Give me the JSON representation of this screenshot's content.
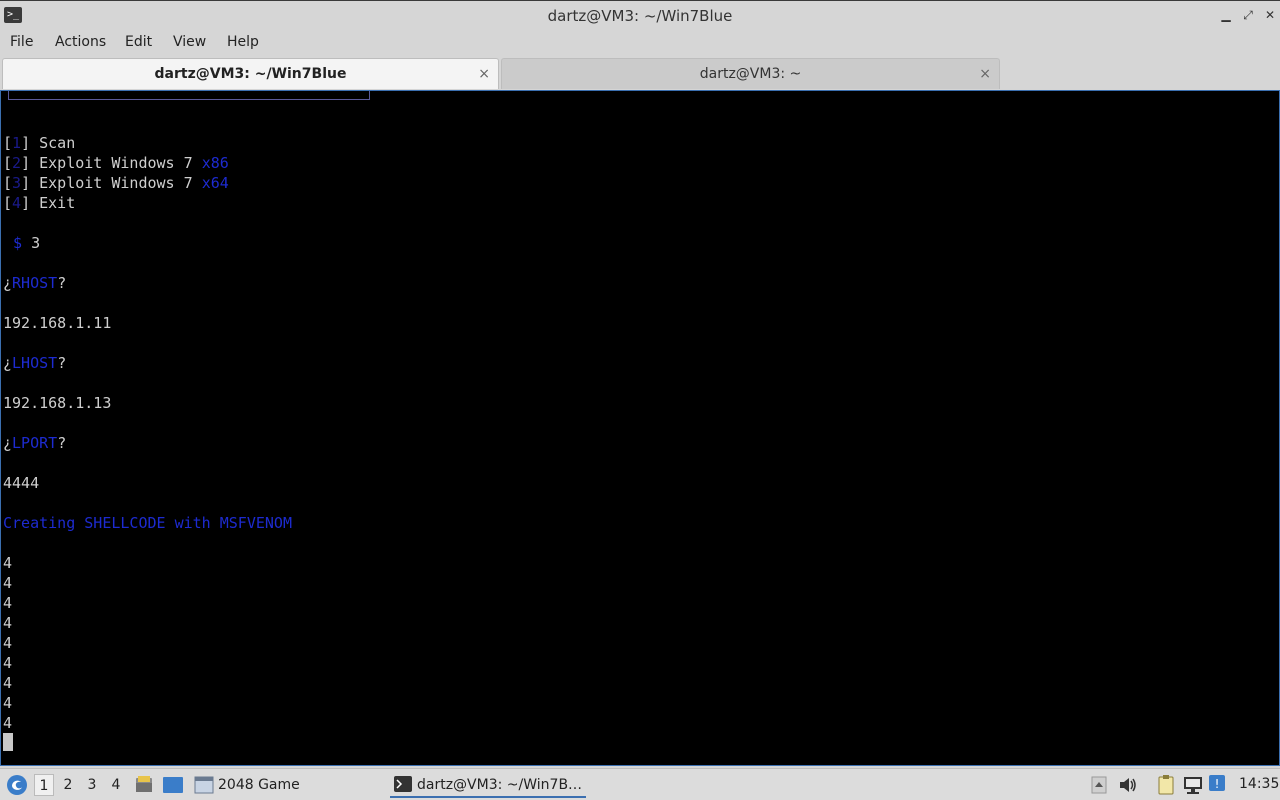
{
  "window": {
    "title": "dartz@VM3: ~/Win7Blue",
    "icon": "terminal-icon",
    "controls": [
      "minimize-icon",
      "maximize-icon",
      "close-icon"
    ]
  },
  "menu": {
    "items": [
      "File",
      "Actions",
      "Edit",
      "View",
      "Help"
    ]
  },
  "tabs": [
    {
      "label": "dartz@VM3: ~/Win7Blue",
      "active": true,
      "close": "×"
    },
    {
      "label": "dartz@VM3: ~",
      "active": false,
      "close": "×"
    }
  ],
  "terminal": {
    "menu_options": [
      {
        "open": "[",
        "num": "1",
        "close": "] ",
        "text": "Scan",
        "suffix": ""
      },
      {
        "open": "[",
        "num": "2",
        "close": "] ",
        "text": "Exploit Windows 7 ",
        "suffix": "x86"
      },
      {
        "open": "[",
        "num": "3",
        "close": "] ",
        "text": "Exploit Windows 7 ",
        "suffix": "x64"
      },
      {
        "open": "[",
        "num": "4",
        "close": "] ",
        "text": "Exit",
        "suffix": ""
      }
    ],
    "prompt_symbol": "$",
    "prompt_input": "3",
    "rhost_q_open": "¿",
    "rhost_label": "RHOST",
    "rhost_q_close": "?",
    "rhost_value": "192.168.1.11",
    "lhost_q_open": "¿",
    "lhost_label": "LHOST",
    "lhost_q_close": "?",
    "lhost_value": "192.168.1.13",
    "lport_q_open": "¿",
    "lport_label": "LPORT",
    "lport_q_close": "?",
    "lport_value": "4444",
    "status_message": "Creating SHELLCODE with MSFVENOM",
    "output_lines": [
      "4",
      "4",
      "4",
      "4",
      "4",
      "4",
      "4",
      "4",
      "4"
    ]
  },
  "taskbar": {
    "start_icon": "start-menu-icon",
    "desktops": [
      "1",
      "2",
      "3",
      "4"
    ],
    "active_desktop": "1",
    "launchers": [
      "file-manager-icon",
      "show-desktop-icon"
    ],
    "tasks": [
      {
        "label": "2048 Game",
        "icon": "window-icon",
        "active": false
      },
      {
        "label": "dartz@VM3: ~/Win7B…",
        "icon": "terminal-icon",
        "active": true
      }
    ],
    "tray_icons": [
      "tray-up-icon",
      "volume-icon",
      "clipboard-icon",
      "network-icon",
      "update-icon"
    ],
    "clock": "14:35"
  }
}
